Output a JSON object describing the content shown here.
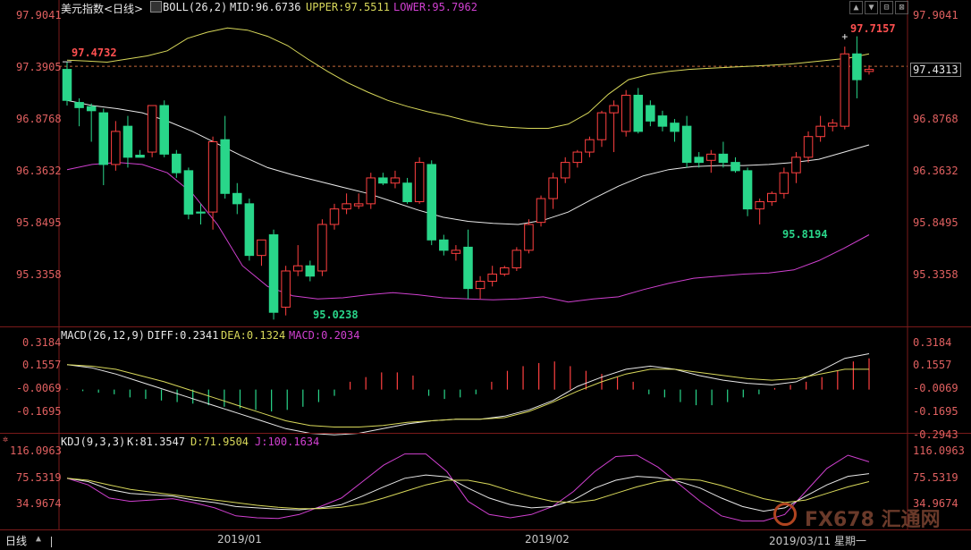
{
  "header": {
    "instrument": "美元指数<日线>",
    "boll_label": "BOLL(26,2)",
    "boll_mid": "MID:96.6736",
    "boll_upper": "UPPER:97.5511",
    "boll_lower": "LOWER:95.7962"
  },
  "window_buttons": [
    "▲",
    "▼",
    "⊟",
    "⊠"
  ],
  "macd_header": {
    "label": "MACD(26,12,9)",
    "diff": "DIFF:0.2341",
    "dea": "DEA:0.1324",
    "macd": "MACD:0.2034"
  },
  "kdj_header": {
    "label": "KDJ(9,3,3)",
    "k": "K:81.3547",
    "d": "D:71.9504",
    "j": "J:100.1634"
  },
  "price_axis_left": [
    "97.9041",
    "97.3905",
    "96.8768",
    "96.3632",
    "95.8495",
    "95.3358"
  ],
  "price_axis_right": [
    "97.9041",
    "96.8768",
    "96.3632",
    "95.8495",
    "95.3358"
  ],
  "current_price": "97.4313",
  "macd_axis_left": [
    "0.3184",
    "0.1557",
    "-0.0069",
    "-0.1695"
  ],
  "macd_axis_right": [
    "0.3184",
    "0.1557",
    "-0.0069",
    "-0.1695",
    "-0.2943"
  ],
  "kdj_axis_left": [
    "116.0963",
    "75.5319",
    "34.9674"
  ],
  "kdj_axis_right": [
    "116.0963",
    "75.5319",
    "34.9674"
  ],
  "annotations": {
    "left_marker": "97.4732",
    "high": "97.7157",
    "low_jan": "95.0238",
    "low_mar": "95.8194"
  },
  "footer": {
    "period": "日线",
    "date1": "2019/01",
    "date2": "2019/02",
    "last_date": "2019/03/11 星期一"
  },
  "watermark": "FX678 汇通网",
  "colors": {
    "up": "#ff4040",
    "down": "#29d68a",
    "mid": "#e8e8e8",
    "upper": "#d8d85a",
    "lower": "#d040d0",
    "axis_text": "#e06060"
  },
  "chart_data": {
    "type": "candlestick",
    "ylim": [
      95.0,
      97.95
    ],
    "candles": [
      {
        "o": 97.4,
        "h": 97.47,
        "c": 97.1,
        "l": 97.05
      },
      {
        "o": 97.08,
        "h": 97.12,
        "c": 97.03,
        "l": 96.85
      },
      {
        "o": 97.04,
        "h": 97.07,
        "c": 97.0,
        "l": 96.7
      },
      {
        "o": 96.98,
        "h": 97.02,
        "c": 96.48,
        "l": 96.28
      },
      {
        "o": 96.48,
        "h": 96.9,
        "c": 96.8,
        "l": 96.42
      },
      {
        "o": 96.85,
        "h": 96.95,
        "c": 96.55,
        "l": 96.45
      },
      {
        "o": 96.57,
        "h": 96.62,
        "c": 96.55,
        "l": 96.55
      },
      {
        "o": 96.6,
        "h": 97.05,
        "c": 97.05,
        "l": 96.55
      },
      {
        "o": 97.05,
        "h": 97.1,
        "c": 96.58,
        "l": 96.55
      },
      {
        "o": 96.58,
        "h": 96.62,
        "c": 96.4,
        "l": 96.35
      },
      {
        "o": 96.42,
        "h": 96.45,
        "c": 96.0,
        "l": 95.95
      },
      {
        "o": 96.02,
        "h": 96.1,
        "c": 96.01,
        "l": 95.9
      },
      {
        "o": 96.02,
        "h": 96.75,
        "c": 96.7,
        "l": 95.85
      },
      {
        "o": 96.72,
        "h": 96.95,
        "c": 96.2,
        "l": 96.15
      },
      {
        "o": 96.2,
        "h": 96.3,
        "c": 96.1,
        "l": 96.0
      },
      {
        "o": 96.1,
        "h": 96.15,
        "c": 95.6,
        "l": 95.55
      },
      {
        "o": 95.6,
        "h": 95.75,
        "c": 95.75,
        "l": 95.5
      },
      {
        "o": 95.8,
        "h": 95.85,
        "c": 95.05,
        "l": 94.98
      },
      {
        "o": 95.1,
        "h": 95.5,
        "c": 95.45,
        "l": 95.02
      },
      {
        "o": 95.45,
        "h": 95.7,
        "c": 95.5,
        "l": 95.4
      },
      {
        "o": 95.5,
        "h": 95.55,
        "c": 95.4,
        "l": 95.35
      },
      {
        "o": 95.45,
        "h": 95.95,
        "c": 95.9,
        "l": 95.4
      },
      {
        "o": 95.9,
        "h": 96.1,
        "c": 96.05,
        "l": 95.85
      },
      {
        "o": 96.05,
        "h": 96.2,
        "c": 96.1,
        "l": 96.0
      },
      {
        "o": 96.08,
        "h": 96.2,
        "c": 96.1,
        "l": 96.05
      },
      {
        "o": 96.1,
        "h": 96.4,
        "c": 96.35,
        "l": 96.05
      },
      {
        "o": 96.35,
        "h": 96.4,
        "c": 96.3,
        "l": 96.28
      },
      {
        "o": 96.3,
        "h": 96.42,
        "c": 96.35,
        "l": 96.25
      },
      {
        "o": 96.3,
        "h": 96.35,
        "c": 96.12,
        "l": 96.1
      },
      {
        "o": 96.12,
        "h": 96.55,
        "c": 96.5,
        "l": 96.1
      },
      {
        "o": 96.48,
        "h": 96.52,
        "c": 95.75,
        "l": 95.7
      },
      {
        "o": 95.75,
        "h": 95.8,
        "c": 95.65,
        "l": 95.6
      },
      {
        "o": 95.62,
        "h": 95.7,
        "c": 95.65,
        "l": 95.55
      },
      {
        "o": 95.68,
        "h": 95.85,
        "c": 95.28,
        "l": 95.18
      },
      {
        "o": 95.28,
        "h": 95.4,
        "c": 95.35,
        "l": 95.18
      },
      {
        "o": 95.35,
        "h": 95.5,
        "c": 95.42,
        "l": 95.3
      },
      {
        "o": 95.42,
        "h": 95.5,
        "c": 95.48,
        "l": 95.4
      },
      {
        "o": 95.48,
        "h": 95.68,
        "c": 95.65,
        "l": 95.45
      },
      {
        "o": 95.65,
        "h": 95.95,
        "c": 95.9,
        "l": 95.62
      },
      {
        "o": 95.92,
        "h": 96.18,
        "c": 96.15,
        "l": 95.88
      },
      {
        "o": 96.15,
        "h": 96.4,
        "c": 96.35,
        "l": 96.05
      },
      {
        "o": 96.35,
        "h": 96.55,
        "c": 96.5,
        "l": 96.3
      },
      {
        "o": 96.5,
        "h": 96.62,
        "c": 96.6,
        "l": 96.45
      },
      {
        "o": 96.6,
        "h": 96.75,
        "c": 96.72,
        "l": 96.55
      },
      {
        "o": 96.72,
        "h": 97.0,
        "c": 96.98,
        "l": 96.65
      },
      {
        "o": 96.98,
        "h": 97.1,
        "c": 97.05,
        "l": 96.6
      },
      {
        "o": 96.8,
        "h": 97.2,
        "c": 97.15,
        "l": 96.75
      },
      {
        "o": 97.15,
        "h": 97.22,
        "c": 96.8,
        "l": 96.78
      },
      {
        "o": 97.05,
        "h": 97.1,
        "c": 96.9,
        "l": 96.85
      },
      {
        "o": 96.95,
        "h": 97.0,
        "c": 96.85,
        "l": 96.8
      },
      {
        "o": 96.88,
        "h": 96.92,
        "c": 96.8,
        "l": 96.7
      },
      {
        "o": 96.85,
        "h": 96.95,
        "c": 96.5,
        "l": 96.45
      },
      {
        "o": 96.55,
        "h": 96.6,
        "c": 96.5,
        "l": 96.45
      },
      {
        "o": 96.52,
        "h": 96.62,
        "c": 96.58,
        "l": 96.4
      },
      {
        "o": 96.58,
        "h": 96.7,
        "c": 96.5,
        "l": 96.45
      },
      {
        "o": 96.5,
        "h": 96.55,
        "c": 96.42,
        "l": 96.4
      },
      {
        "o": 96.42,
        "h": 96.45,
        "c": 96.05,
        "l": 95.98
      },
      {
        "o": 96.05,
        "h": 96.15,
        "c": 96.12,
        "l": 95.9
      },
      {
        "o": 96.12,
        "h": 96.22,
        "c": 96.2,
        "l": 96.08
      },
      {
        "o": 96.2,
        "h": 96.45,
        "c": 96.4,
        "l": 96.15
      },
      {
        "o": 96.4,
        "h": 96.6,
        "c": 96.55,
        "l": 96.3
      },
      {
        "o": 96.55,
        "h": 96.8,
        "c": 96.75,
        "l": 96.5
      },
      {
        "o": 96.75,
        "h": 96.95,
        "c": 96.85,
        "l": 96.7
      },
      {
        "o": 96.85,
        "h": 96.92,
        "c": 96.88,
        "l": 96.8
      },
      {
        "o": 96.85,
        "h": 97.62,
        "c": 97.55,
        "l": 96.82
      },
      {
        "o": 97.55,
        "h": 97.72,
        "c": 97.3,
        "l": 97.12
      },
      {
        "o": 97.38,
        "h": 97.44,
        "c": 97.4,
        "l": 97.35
      }
    ],
    "boll": {
      "upper": [
        97.49,
        97.48,
        97.47,
        97.5,
        97.53,
        97.58,
        97.7,
        97.76,
        97.8,
        97.78,
        97.72,
        97.63,
        97.5,
        97.38,
        97.27,
        97.18,
        97.1,
        97.04,
        96.99,
        96.95,
        96.9,
        96.86,
        96.84,
        96.83,
        96.83,
        96.87,
        96.98,
        97.16,
        97.3,
        97.35,
        97.38,
        97.4,
        97.41,
        97.42,
        97.43,
        97.44,
        97.45,
        97.47,
        97.49,
        97.51,
        97.55
      ],
      "mid": [
        97.1,
        97.05,
        97.02,
        96.98,
        96.9,
        96.8,
        96.68,
        96.56,
        96.45,
        96.38,
        96.32,
        96.26,
        96.2,
        96.12,
        96.04,
        95.97,
        95.93,
        95.91,
        95.9,
        95.94,
        96.02,
        96.15,
        96.27,
        96.37,
        96.43,
        96.46,
        96.47,
        96.47,
        96.48,
        96.5,
        96.53,
        96.6,
        96.67
      ],
      "lower": [
        96.43,
        96.48,
        96.5,
        96.48,
        96.4,
        96.2,
        95.9,
        95.5,
        95.3,
        95.21,
        95.18,
        95.19,
        95.22,
        95.24,
        95.22,
        95.19,
        95.18,
        95.17,
        95.18,
        95.2,
        95.15,
        95.18,
        95.2,
        95.27,
        95.33,
        95.38,
        95.4,
        95.42,
        95.43,
        95.46,
        95.55,
        95.67,
        95.8
      ]
    },
    "macd": {
      "ylim": [
        -0.3,
        0.33
      ],
      "diff": [
        0.16,
        0.14,
        0.1,
        0.05,
        0.0,
        -0.05,
        -0.1,
        -0.15,
        -0.2,
        -0.25,
        -0.28,
        -0.29,
        -0.28,
        -0.25,
        -0.22,
        -0.2,
        -0.19,
        -0.19,
        -0.17,
        -0.13,
        -0.07,
        0.02,
        0.08,
        0.13,
        0.15,
        0.13,
        0.09,
        0.06,
        0.04,
        0.03,
        0.05,
        0.12,
        0.2,
        0.23
      ],
      "dea": [
        0.16,
        0.15,
        0.13,
        0.09,
        0.05,
        0.0,
        -0.05,
        -0.1,
        -0.15,
        -0.2,
        -0.23,
        -0.24,
        -0.24,
        -0.23,
        -0.21,
        -0.2,
        -0.19,
        -0.19,
        -0.18,
        -0.14,
        -0.08,
        -0.01,
        0.05,
        0.1,
        0.13,
        0.13,
        0.11,
        0.09,
        0.07,
        0.06,
        0.07,
        0.1,
        0.13,
        0.13
      ],
      "hist": [
        0.005,
        -0.01,
        -0.02,
        -0.03,
        -0.05,
        -0.06,
        -0.07,
        -0.08,
        -0.09,
        -0.1,
        -0.11,
        -0.12,
        -0.13,
        -0.14,
        -0.13,
        -0.11,
        -0.08,
        -0.04,
        0.05,
        0.08,
        0.11,
        0.11,
        0.09,
        -0.04,
        -0.06,
        -0.05,
        -0.03,
        0.05,
        0.12,
        0.15,
        0.17,
        0.18,
        0.15,
        0.12,
        0.1,
        0.08,
        0.05,
        -0.03,
        -0.05,
        -0.08,
        -0.1,
        -0.1,
        -0.08,
        -0.05,
        -0.03,
        0.01,
        0.03,
        0.05,
        0.08,
        0.12,
        0.18,
        0.2
      ]
    },
    "kdj": {
      "ylim": [
        0,
        125
      ],
      "k": [
        75,
        70,
        58,
        52,
        50,
        48,
        42,
        38,
        32,
        30,
        28,
        27,
        30,
        35,
        48,
        62,
        75,
        80,
        77,
        60,
        45,
        35,
        30,
        32,
        42,
        60,
        72,
        78,
        76,
        70,
        60,
        45,
        32,
        25,
        30,
        48,
        65,
        78,
        82
      ],
      "d": [
        75,
        72,
        65,
        58,
        54,
        50,
        46,
        42,
        38,
        34,
        31,
        29,
        29,
        31,
        36,
        45,
        55,
        65,
        72,
        72,
        66,
        56,
        47,
        40,
        38,
        42,
        52,
        62,
        70,
        74,
        72,
        64,
        54,
        44,
        38,
        42,
        52,
        62,
        70
      ],
      "j": [
        75,
        65,
        45,
        40,
        42,
        44,
        38,
        30,
        18,
        15,
        14,
        20,
        32,
        45,
        70,
        95,
        112,
        112,
        85,
        40,
        20,
        15,
        20,
        32,
        55,
        85,
        108,
        110,
        92,
        66,
        40,
        18,
        10,
        10,
        20,
        55,
        90,
        110,
        100
      ]
    }
  }
}
